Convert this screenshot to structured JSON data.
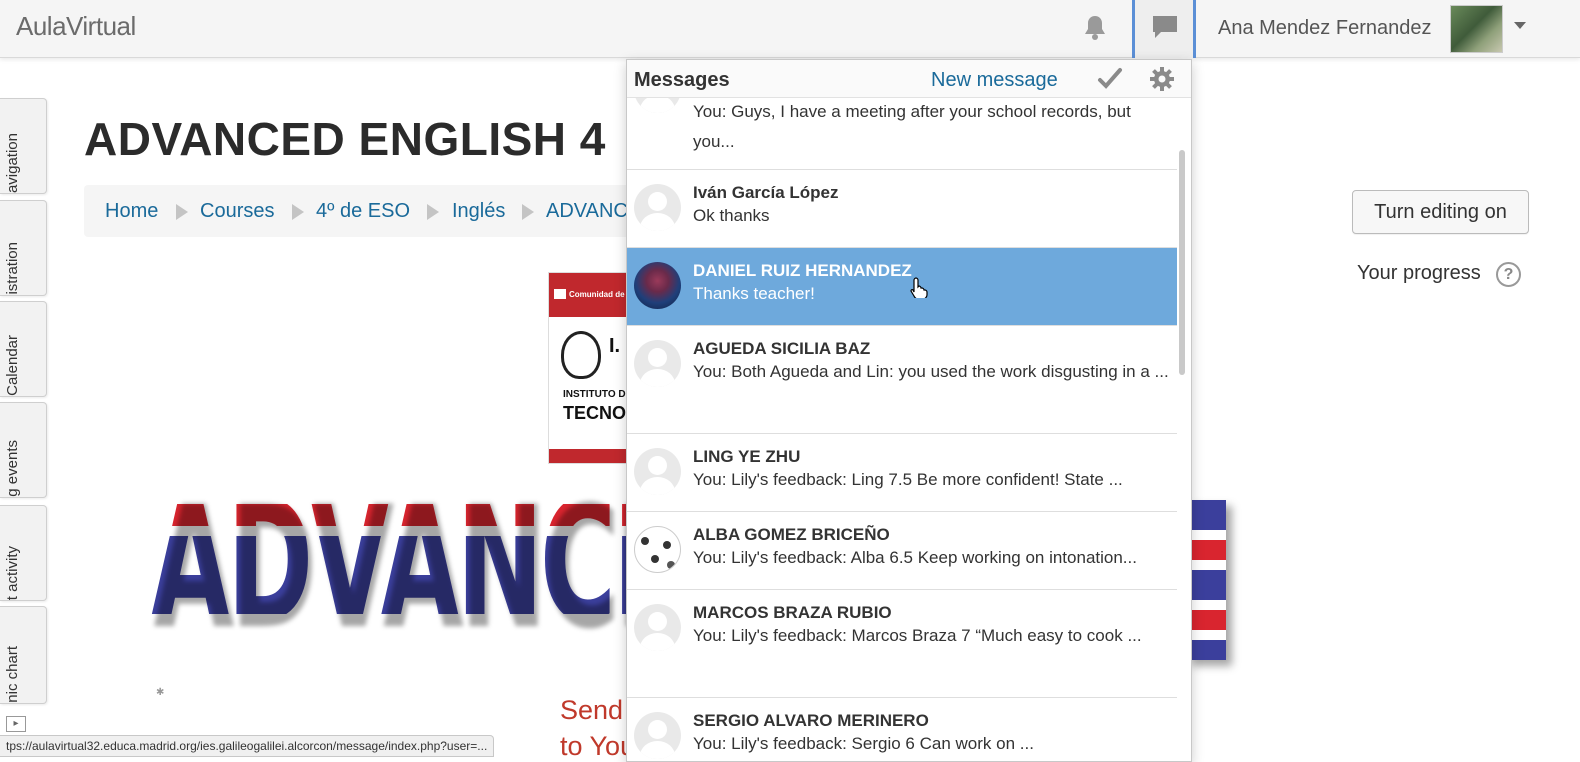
{
  "navbar": {
    "brand": "AulaVirtual",
    "user_name": "Ana Mendez Fernandez",
    "icons": [
      "bell-icon",
      "chat-icon",
      "caret-down-icon"
    ]
  },
  "dock": {
    "tabs": [
      {
        "label": "avigation"
      },
      {
        "label": "istration"
      },
      {
        "label": "Calendar"
      },
      {
        "label": "g events"
      },
      {
        "label": "t activity"
      },
      {
        "label": "nic chart"
      }
    ]
  },
  "course": {
    "title": "ADVANCED ENGLISH 4",
    "breadcrumb": [
      "Home",
      "Courses",
      "4º de ESO",
      "Inglés",
      "ADVANC"
    ],
    "logo_header": "Comunidad de Ma",
    "logo_line1": "INSTITUTO DE I",
    "logo_line2": "TECNOL",
    "logo_letters": "I.",
    "banner_text": "ADVANCED",
    "send_line1": "Send",
    "send_line2": "to You"
  },
  "right_panel": {
    "edit_button": "Turn editing on",
    "progress_label": "Your progress",
    "help_icon": "?"
  },
  "status_url": "tps://aulavirtual32.educa.madrid.org/ies.galileogalilei.alcorcon/message/index.php?user=...",
  "messages": {
    "title": "Messages",
    "new_message": "New message",
    "items": [
      {
        "name": "",
        "text": "You: Guys, I have a meeting after your school records, but you..."
      },
      {
        "name": "Iván García López",
        "text": "Ok thanks"
      },
      {
        "name": "DANIEL RUIZ HERNANDEZ",
        "text": "Thanks teacher!"
      },
      {
        "name": "AGUEDA SICILIA BAZ",
        "text": "You: Both Agueda and Lin: you used the work disgusting in a ..."
      },
      {
        "name": "LING YE ZHU",
        "text": "You: Lily's feedback: Ling 7.5 Be more confident! State ..."
      },
      {
        "name": "ALBA GOMEZ BRICEÑO",
        "text": "You: Lily's feedback: Alba 6.5 Keep working on intonation..."
      },
      {
        "name": "MARCOS BRAZA RUBIO",
        "text": "You: Lily's feedback: Marcos Braza 7 “Much easy to cook ..."
      },
      {
        "name": "SERGIO ALVARO MERINERO",
        "text": "You: Lily's feedback: Sergio 6 Can work on ..."
      }
    ]
  },
  "colors": {
    "link": "#1a6a9a",
    "selected_row": "#6ea9dc",
    "accent_border": "#5b8fd6",
    "send_text": "#c0392b"
  }
}
